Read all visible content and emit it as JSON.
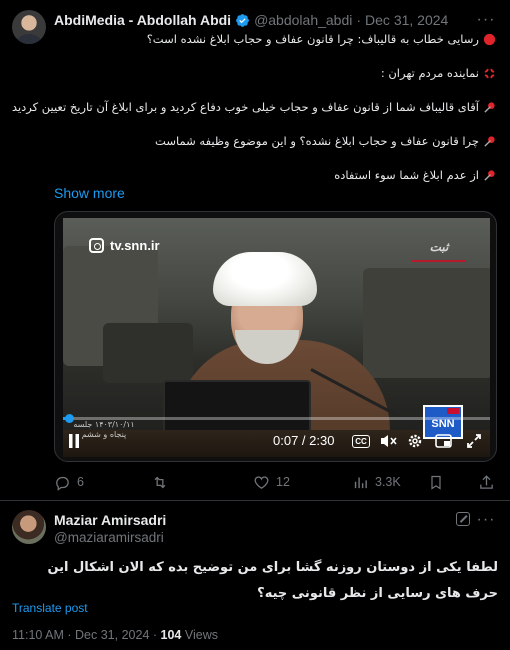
{
  "tweet": {
    "author_name": "AbdiMedia - Abdollah Abdi",
    "handle": "@abdolah_abdi",
    "separator": "·",
    "date": "Dec 31, 2024",
    "lines": [
      {
        "emoji": "red-circle-icon",
        "text": "رسایی خطاب به قالیباف: چرا قانون عفاف و حجاب ابلاغ نشده است؟"
      },
      {
        "emoji": "anger-symbol-icon",
        "text": "نماینده مردم تهران :"
      },
      {
        "emoji": "pushpin-icon",
        "text": "آقای قالیباف شما از قانون عفاف و حجاب خیلی خوب دفاع کردید و برای ابلاغ آن تاریخ تعیین کردید"
      },
      {
        "emoji": "pushpin-icon",
        "text": "چرا قانون عفاف و حجاب ابلاغ نشده؟ و این موضوع وظیفه شماست"
      },
      {
        "emoji": "pushpin-icon",
        "text": "از عدم ابلاغ شما سوء استفاده"
      }
    ],
    "show_more": "Show more",
    "video": {
      "watermark": "tv.snn.ir",
      "top_logo": "ثبت",
      "channel_logo": "SNN",
      "chyron": "۱۴۰۳/۱۰/۱۱ جلسه پنجاه و ششم",
      "progress_fraction": 0.015,
      "time": "0:07 / 2:30"
    },
    "stats": {
      "replies": "6",
      "reposts": "",
      "likes": "12",
      "views": "3.3K"
    },
    "colors": {
      "accent": "#1d9bf0",
      "muted": "#71767b",
      "verified": "#1d9bf0"
    }
  },
  "reply": {
    "author_name": "Maziar Amirsadri",
    "handle": "@maziaramirsadri",
    "text": "لطفا یکی از دوستان روزنه گشا برای من توضیح بده که الان اشکال این حرف های رسایی از نظر قانونی چیه؟",
    "translate": "Translate post",
    "time": "11:10 AM",
    "separator": "·",
    "date": "Dec 31, 2024",
    "views_count": "104",
    "views_label": "Views"
  }
}
